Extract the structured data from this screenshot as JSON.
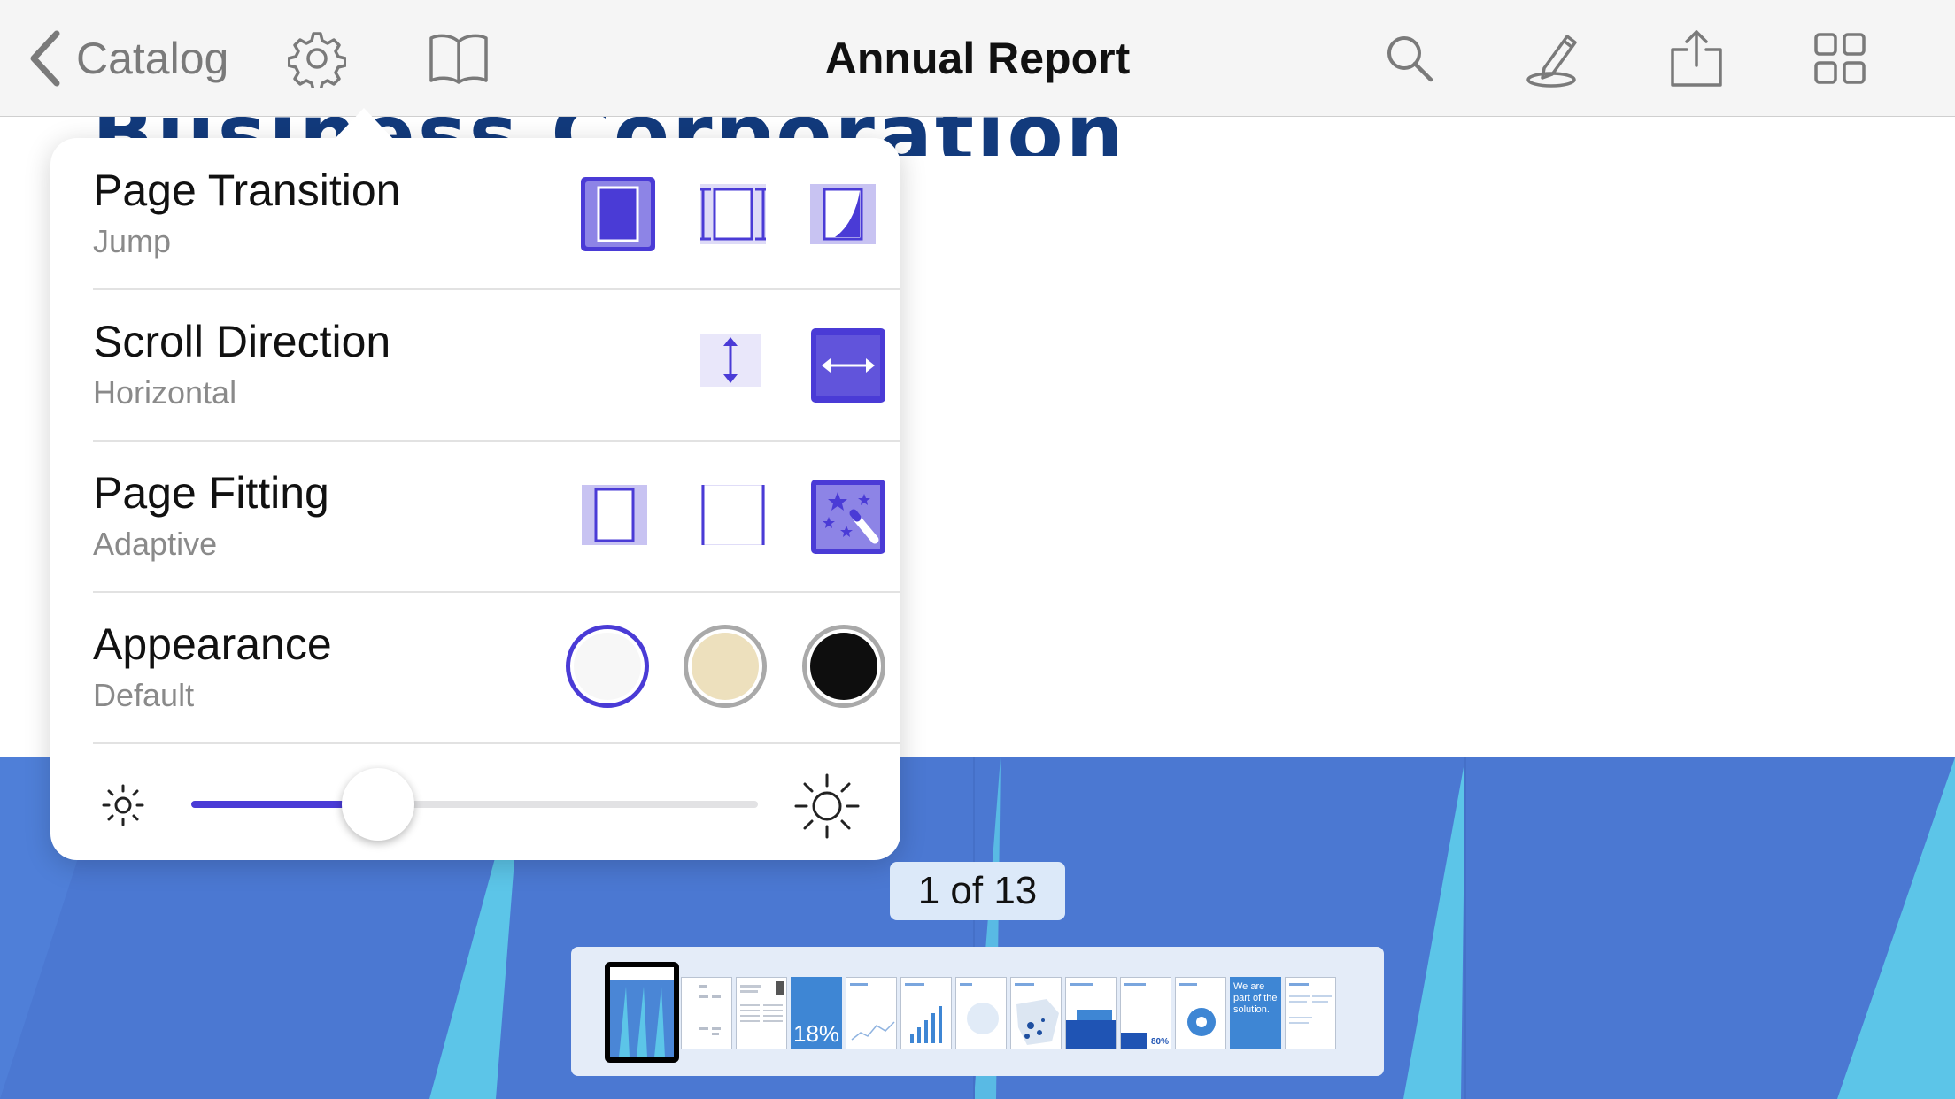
{
  "document": {
    "heading_fragment": "Business Corporation",
    "banner_color": "#4b78d2",
    "banner_accent_color": "#5cc5e8"
  },
  "toolbar": {
    "back_label": "Catalog",
    "title": "Annual Report",
    "left_icons": [
      "chevron-left-icon",
      "gear-icon",
      "book-icon"
    ],
    "right_icons": [
      "search-icon",
      "pen-icon",
      "share-icon",
      "grid-icon"
    ]
  },
  "settings": {
    "accent_color": "#4a3bd6",
    "page_transition": {
      "title": "Page Transition",
      "value": "Jump",
      "options": [
        "jump-transition-icon",
        "slide-transition-icon",
        "curl-transition-icon"
      ],
      "selected_index": 0
    },
    "scroll_direction": {
      "title": "Scroll Direction",
      "value": "Horizontal",
      "options": [
        "vertical-scroll-icon",
        "horizontal-scroll-icon"
      ],
      "selected_index": 1
    },
    "page_fitting": {
      "title": "Page Fitting",
      "value": "Adaptive",
      "options": [
        "fit-page-icon",
        "fit-width-icon",
        "magic-wand-icon"
      ],
      "selected_index": 2
    },
    "appearance": {
      "title": "Appearance",
      "value": "Default",
      "options": [
        {
          "name": "default",
          "color": "#f7f7f7"
        },
        {
          "name": "sepia",
          "color": "#ede0bd"
        },
        {
          "name": "night",
          "color": "#0e0e0e"
        }
      ],
      "selected_index": 0
    },
    "brightness": {
      "value": 0.33,
      "low_icon": "brightness-low-icon",
      "high_icon": "brightness-high-icon"
    }
  },
  "pager": {
    "label": "1 of 13",
    "current_page": 1,
    "total_pages": 13
  },
  "thumbnails": {
    "page4_text": "18%",
    "page12_text": "We are part of the solution.",
    "page10_text": "80%"
  }
}
